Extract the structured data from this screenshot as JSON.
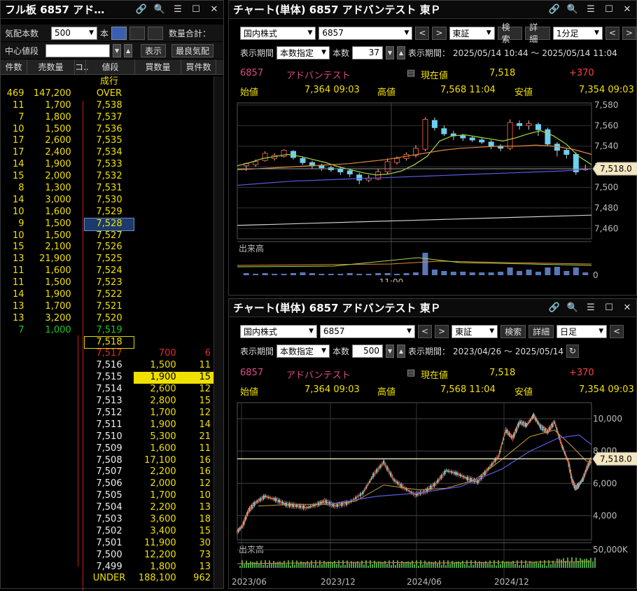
{
  "orderbook": {
    "title": "フル板 6857 アド…",
    "qty_label": "気配本数",
    "qty_value": "500",
    "unit_label": "本",
    "total_label": "数量合計：",
    "center_label": "中心値段",
    "show_btn": "表示",
    "best_btn": "最良気配",
    "headers": [
      "件数",
      "売数量",
      "コ..",
      "値段",
      "買数量",
      "買件数"
    ],
    "market_label": "成行",
    "over_row": {
      "count": "469",
      "qty": "147,200",
      "price": "OVER"
    },
    "under_row": {
      "price": "UNDER",
      "qty": "188,100",
      "count": "962"
    },
    "ask_rows": [
      [
        "11",
        "1,700",
        "7,538"
      ],
      [
        "7",
        "1,800",
        "7,537"
      ],
      [
        "10",
        "1,500",
        "7,536"
      ],
      [
        "17",
        "2,600",
        "7,535"
      ],
      [
        "17",
        "2,400",
        "7,534"
      ],
      [
        "14",
        "1,900",
        "7,533"
      ],
      [
        "15",
        "2,000",
        "7,532"
      ],
      [
        "8",
        "1,300",
        "7,531"
      ],
      [
        "14",
        "3,000",
        "7,530"
      ],
      [
        "10",
        "1,600",
        "7,529"
      ],
      [
        "9",
        "1,500",
        "7,528"
      ],
      [
        "10",
        "1,500",
        "7,527"
      ],
      [
        "15",
        "2,100",
        "7,526"
      ],
      [
        "13",
        "21,900",
        "7,525"
      ],
      [
        "11",
        "1,600",
        "7,524"
      ],
      [
        "11",
        "1,500",
        "7,523"
      ],
      [
        "14",
        "1,900",
        "7,522"
      ],
      [
        "13",
        "1,700",
        "7,521"
      ],
      [
        "13",
        "3,200",
        "7,520"
      ],
      [
        "7",
        "1,000",
        "7,519"
      ]
    ],
    "current_price": "7,518",
    "bid_rows": [
      [
        "7,517",
        "700",
        "6"
      ],
      [
        "7,516",
        "1,500",
        "11"
      ],
      [
        "7,515",
        "1,900",
        "15"
      ],
      [
        "7,514",
        "2,600",
        "12"
      ],
      [
        "7,513",
        "2,800",
        "15"
      ],
      [
        "7,512",
        "1,700",
        "12"
      ],
      [
        "7,511",
        "1,900",
        "14"
      ],
      [
        "7,510",
        "5,300",
        "21"
      ],
      [
        "7,509",
        "1,600",
        "11"
      ],
      [
        "7,508",
        "17,100",
        "16"
      ],
      [
        "7,507",
        "2,200",
        "16"
      ],
      [
        "7,506",
        "2,000",
        "12"
      ],
      [
        "7,505",
        "1,700",
        "10"
      ],
      [
        "7,504",
        "2,200",
        "13"
      ],
      [
        "7,503",
        "3,600",
        "18"
      ],
      [
        "7,502",
        "3,400",
        "15"
      ],
      [
        "7,501",
        "11,900",
        "30"
      ],
      [
        "7,500",
        "12,200",
        "73"
      ],
      [
        "7,499",
        "1,800",
        "13"
      ]
    ]
  },
  "chart1": {
    "title": "チャート(単体) 6857 アドバンテスト 東Ｐ",
    "market": "国内株式",
    "code": "6857",
    "exchange": "東証",
    "search_btn": "検索",
    "detail_btn": "詳細",
    "interval": "1分足",
    "period_label": "表示期間",
    "period_mode": "本数指定",
    "count_label": "本数",
    "count": "37",
    "range_label": "表示期間：",
    "range": "2025/05/14 10:44 ～ 2025/05/14 11:04",
    "name_code": "6857",
    "name": "アドバンテスト",
    "cur_label": "現在値",
    "cur_value": "7,518",
    "change": "+370",
    "open_label": "始値",
    "open": "7,364 09:03",
    "high_label": "高値",
    "high": "7,568 11:04",
    "low_label": "安値",
    "low": "7,354 09:03",
    "price_tag": "7,518.0",
    "volume_label": "出来高",
    "time_label": "11:00",
    "yticks": [
      "7,580",
      "7,560",
      "7,540",
      "7,520",
      "7,500",
      "7,480",
      "7,460"
    ]
  },
  "chart2": {
    "title": "チャート(単体) 6857 アドバンテスト 東Ｐ",
    "market": "国内株式",
    "code": "6857",
    "exchange": "東証",
    "search_btn": "検索",
    "detail_btn": "詳細",
    "interval": "日足",
    "period_label": "表示期間",
    "period_mode": "本数指定",
    "count_label": "本数",
    "count": "500",
    "range_label": "表示期間：",
    "range": "2023/04/26 ～ 2025/05/14",
    "name_code": "6857",
    "name": "アドバンテスト",
    "cur_label": "現在値",
    "cur_value": "7,518",
    "change": "+370",
    "open_label": "始値",
    "open": "7,364 09:03",
    "high_label": "高値",
    "high": "7,568 11:04",
    "low_label": "安値",
    "low": "7,354 09:03",
    "price_tag": "7,518.0",
    "volume_label": "出来高",
    "vol_tick": "50,000K",
    "yticks": [
      "10,000",
      "8,000",
      "6,000",
      "4,000"
    ],
    "xticks": [
      "2023/06",
      "2023/12",
      "2024/06",
      "2024/12"
    ]
  },
  "colors": {
    "ask_qty": "#f0e000",
    "bid_price": "#e02a2a",
    "green": "#1ec81e",
    "bg": "#000000",
    "accent": "#e8b500"
  }
}
